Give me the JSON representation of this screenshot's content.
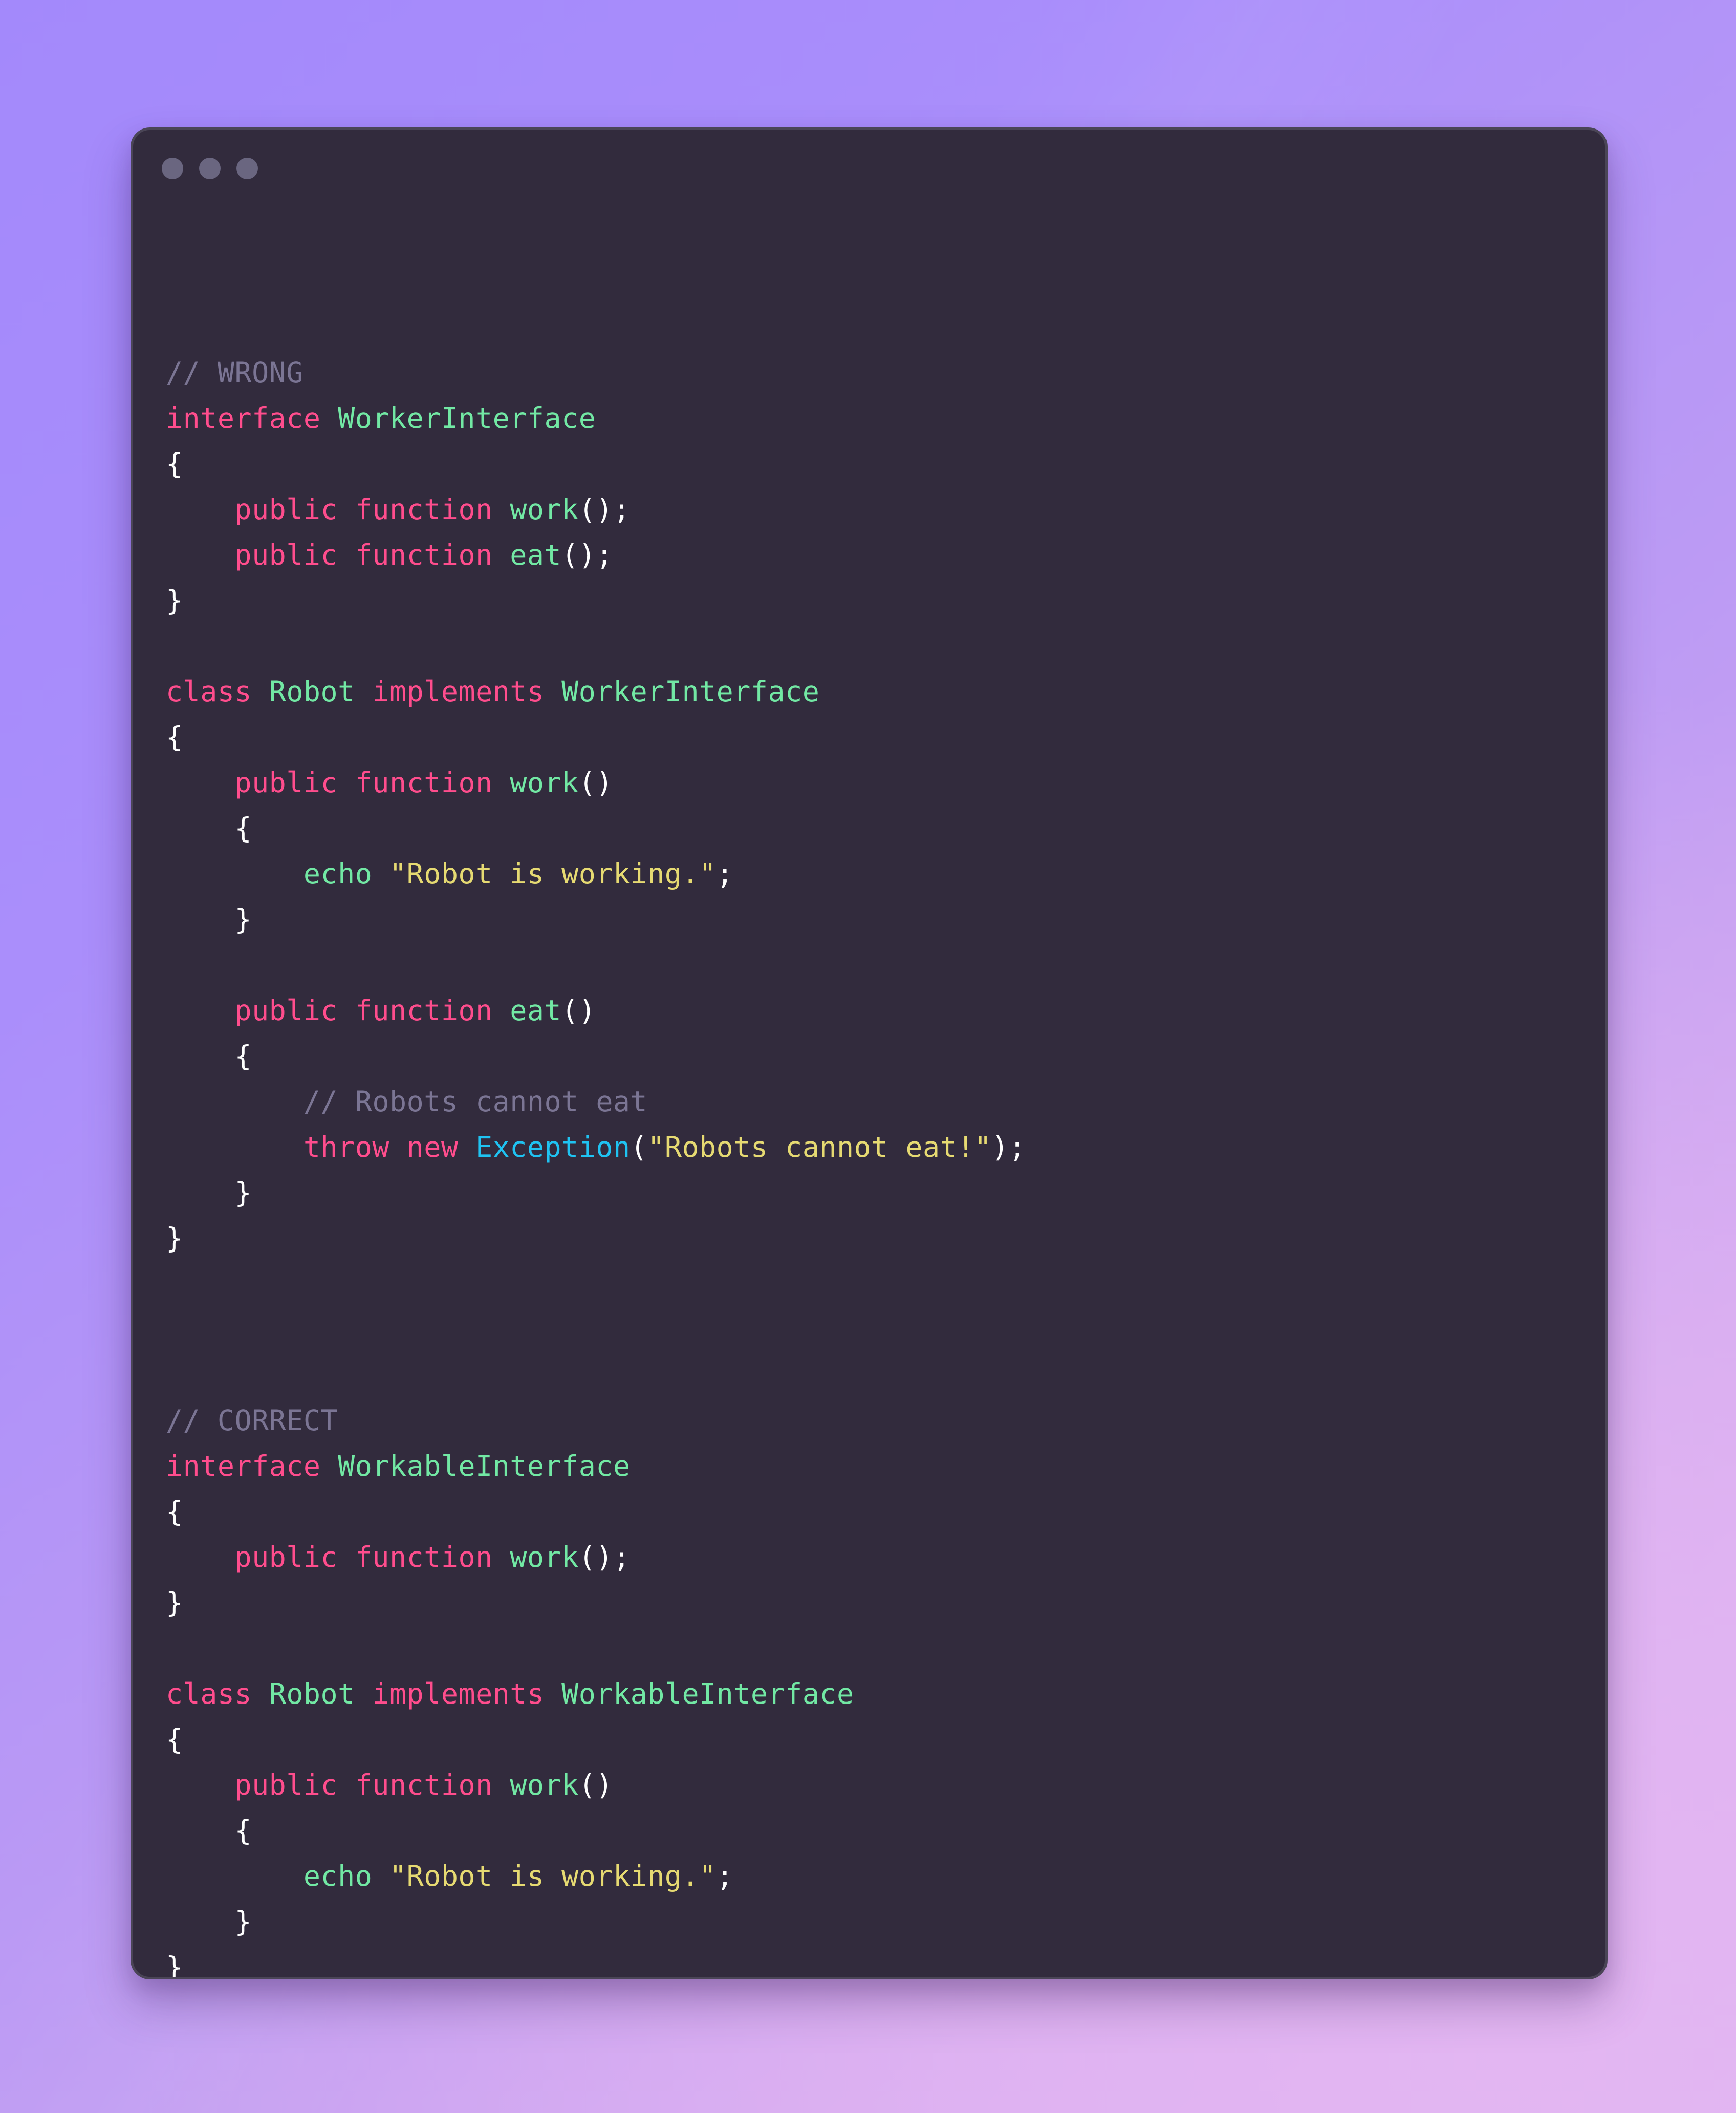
{
  "window": {
    "name": "code-snippet-window",
    "traffic_lights": [
      "close-dot",
      "minimize-dot",
      "maximize-dot"
    ],
    "background_color": "#322b3d",
    "border_color": "#4a4556"
  },
  "page": {
    "background_gradient_from": "#a389fb",
    "background_gradient_to": "#ddb0ef"
  },
  "theme": {
    "comment": "#7b7594",
    "keyword": "#ff4d8d",
    "type": "#72e8a4",
    "function": "#72e8a4",
    "string": "#e6da72",
    "class": "#1fc3f2",
    "punctuation": "#ffffff",
    "plain": "#f5f3f8"
  },
  "code": {
    "language": "php",
    "lines": [
      {
        "id": 1,
        "text": "// WRONG",
        "tokens": [
          {
            "t": "// WRONG",
            "c": "comment"
          }
        ]
      },
      {
        "id": 2,
        "text": "interface WorkerInterface",
        "tokens": [
          {
            "t": "interface",
            "c": "keyword"
          },
          {
            "t": " ",
            "c": "plain"
          },
          {
            "t": "WorkerInterface",
            "c": "type"
          }
        ]
      },
      {
        "id": 3,
        "text": "{",
        "tokens": [
          {
            "t": "{",
            "c": "punct"
          }
        ]
      },
      {
        "id": 4,
        "text": "    public function work();",
        "tokens": [
          {
            "t": "    ",
            "c": "plain"
          },
          {
            "t": "public",
            "c": "keyword"
          },
          {
            "t": " ",
            "c": "plain"
          },
          {
            "t": "function",
            "c": "keyword"
          },
          {
            "t": " ",
            "c": "plain"
          },
          {
            "t": "work",
            "c": "func"
          },
          {
            "t": "();",
            "c": "punct"
          }
        ]
      },
      {
        "id": 5,
        "text": "    public function eat();",
        "tokens": [
          {
            "t": "    ",
            "c": "plain"
          },
          {
            "t": "public",
            "c": "keyword"
          },
          {
            "t": " ",
            "c": "plain"
          },
          {
            "t": "function",
            "c": "keyword"
          },
          {
            "t": " ",
            "c": "plain"
          },
          {
            "t": "eat",
            "c": "func"
          },
          {
            "t": "();",
            "c": "punct"
          }
        ]
      },
      {
        "id": 6,
        "text": "}",
        "tokens": [
          {
            "t": "}",
            "c": "punct"
          }
        ]
      },
      {
        "id": 7,
        "text": "",
        "tokens": []
      },
      {
        "id": 8,
        "text": "class Robot implements WorkerInterface",
        "tokens": [
          {
            "t": "class",
            "c": "keyword"
          },
          {
            "t": " ",
            "c": "plain"
          },
          {
            "t": "Robot",
            "c": "type"
          },
          {
            "t": " ",
            "c": "plain"
          },
          {
            "t": "implements",
            "c": "keyword"
          },
          {
            "t": " ",
            "c": "plain"
          },
          {
            "t": "WorkerInterface",
            "c": "type"
          }
        ]
      },
      {
        "id": 9,
        "text": "{",
        "tokens": [
          {
            "t": "{",
            "c": "punct"
          }
        ]
      },
      {
        "id": 10,
        "text": "    public function work()",
        "tokens": [
          {
            "t": "    ",
            "c": "plain"
          },
          {
            "t": "public",
            "c": "keyword"
          },
          {
            "t": " ",
            "c": "plain"
          },
          {
            "t": "function",
            "c": "keyword"
          },
          {
            "t": " ",
            "c": "plain"
          },
          {
            "t": "work",
            "c": "func"
          },
          {
            "t": "()",
            "c": "punct"
          }
        ]
      },
      {
        "id": 11,
        "text": "    {",
        "tokens": [
          {
            "t": "    ",
            "c": "plain"
          },
          {
            "t": "{",
            "c": "punct"
          }
        ]
      },
      {
        "id": 12,
        "text": "        echo \"Robot is working.\";",
        "tokens": [
          {
            "t": "        ",
            "c": "plain"
          },
          {
            "t": "echo",
            "c": "func"
          },
          {
            "t": " ",
            "c": "plain"
          },
          {
            "t": "\"Robot is working.\"",
            "c": "string"
          },
          {
            "t": ";",
            "c": "punct"
          }
        ]
      },
      {
        "id": 13,
        "text": "    }",
        "tokens": [
          {
            "t": "    ",
            "c": "plain"
          },
          {
            "t": "}",
            "c": "punct"
          }
        ]
      },
      {
        "id": 14,
        "text": "",
        "tokens": []
      },
      {
        "id": 15,
        "text": "    public function eat()",
        "tokens": [
          {
            "t": "    ",
            "c": "plain"
          },
          {
            "t": "public",
            "c": "keyword"
          },
          {
            "t": " ",
            "c": "plain"
          },
          {
            "t": "function",
            "c": "keyword"
          },
          {
            "t": " ",
            "c": "plain"
          },
          {
            "t": "eat",
            "c": "func"
          },
          {
            "t": "()",
            "c": "punct"
          }
        ]
      },
      {
        "id": 16,
        "text": "    {",
        "tokens": [
          {
            "t": "    ",
            "c": "plain"
          },
          {
            "t": "{",
            "c": "punct"
          }
        ]
      },
      {
        "id": 17,
        "text": "        // Robots cannot eat",
        "tokens": [
          {
            "t": "        ",
            "c": "plain"
          },
          {
            "t": "// Robots cannot eat",
            "c": "comment"
          }
        ]
      },
      {
        "id": 18,
        "text": "        throw new Exception(\"Robots cannot eat!\");",
        "tokens": [
          {
            "t": "        ",
            "c": "plain"
          },
          {
            "t": "throw",
            "c": "keyword"
          },
          {
            "t": " ",
            "c": "plain"
          },
          {
            "t": "new",
            "c": "keyword"
          },
          {
            "t": " ",
            "c": "plain"
          },
          {
            "t": "Exception",
            "c": "class"
          },
          {
            "t": "(",
            "c": "punct"
          },
          {
            "t": "\"Robots cannot eat!\"",
            "c": "string"
          },
          {
            "t": ");",
            "c": "punct"
          }
        ]
      },
      {
        "id": 19,
        "text": "    }",
        "tokens": [
          {
            "t": "    ",
            "c": "plain"
          },
          {
            "t": "}",
            "c": "punct"
          }
        ]
      },
      {
        "id": 20,
        "text": "}",
        "tokens": [
          {
            "t": "}",
            "c": "punct"
          }
        ]
      },
      {
        "id": 21,
        "text": "",
        "tokens": []
      },
      {
        "id": 22,
        "text": "",
        "tokens": []
      },
      {
        "id": 23,
        "text": "",
        "tokens": []
      },
      {
        "id": 24,
        "text": "// CORRECT",
        "tokens": [
          {
            "t": "// CORRECT",
            "c": "comment"
          }
        ]
      },
      {
        "id": 25,
        "text": "interface WorkableInterface",
        "tokens": [
          {
            "t": "interface",
            "c": "keyword"
          },
          {
            "t": " ",
            "c": "plain"
          },
          {
            "t": "WorkableInterface",
            "c": "type"
          }
        ]
      },
      {
        "id": 26,
        "text": "{",
        "tokens": [
          {
            "t": "{",
            "c": "punct"
          }
        ]
      },
      {
        "id": 27,
        "text": "    public function work();",
        "tokens": [
          {
            "t": "    ",
            "c": "plain"
          },
          {
            "t": "public",
            "c": "keyword"
          },
          {
            "t": " ",
            "c": "plain"
          },
          {
            "t": "function",
            "c": "keyword"
          },
          {
            "t": " ",
            "c": "plain"
          },
          {
            "t": "work",
            "c": "func"
          },
          {
            "t": "();",
            "c": "punct"
          }
        ]
      },
      {
        "id": 28,
        "text": "}",
        "tokens": [
          {
            "t": "}",
            "c": "punct"
          }
        ]
      },
      {
        "id": 29,
        "text": "",
        "tokens": []
      },
      {
        "id": 30,
        "text": "class Robot implements WorkableInterface",
        "tokens": [
          {
            "t": "class",
            "c": "keyword"
          },
          {
            "t": " ",
            "c": "plain"
          },
          {
            "t": "Robot",
            "c": "type"
          },
          {
            "t": " ",
            "c": "plain"
          },
          {
            "t": "implements",
            "c": "keyword"
          },
          {
            "t": " ",
            "c": "plain"
          },
          {
            "t": "WorkableInterface",
            "c": "type"
          }
        ]
      },
      {
        "id": 31,
        "text": "{",
        "tokens": [
          {
            "t": "{",
            "c": "punct"
          }
        ]
      },
      {
        "id": 32,
        "text": "    public function work()",
        "tokens": [
          {
            "t": "    ",
            "c": "plain"
          },
          {
            "t": "public",
            "c": "keyword"
          },
          {
            "t": " ",
            "c": "plain"
          },
          {
            "t": "function",
            "c": "keyword"
          },
          {
            "t": " ",
            "c": "plain"
          },
          {
            "t": "work",
            "c": "func"
          },
          {
            "t": "()",
            "c": "punct"
          }
        ]
      },
      {
        "id": 33,
        "text": "    {",
        "tokens": [
          {
            "t": "    ",
            "c": "plain"
          },
          {
            "t": "{",
            "c": "punct"
          }
        ]
      },
      {
        "id": 34,
        "text": "        echo \"Robot is working.\";",
        "tokens": [
          {
            "t": "        ",
            "c": "plain"
          },
          {
            "t": "echo",
            "c": "func"
          },
          {
            "t": " ",
            "c": "plain"
          },
          {
            "t": "\"Robot is working.\"",
            "c": "string"
          },
          {
            "t": ";",
            "c": "punct"
          }
        ]
      },
      {
        "id": 35,
        "text": "    }",
        "tokens": [
          {
            "t": "    ",
            "c": "plain"
          },
          {
            "t": "}",
            "c": "punct"
          }
        ]
      },
      {
        "id": 36,
        "text": "}",
        "tokens": [
          {
            "t": "}",
            "c": "punct"
          }
        ]
      }
    ]
  }
}
